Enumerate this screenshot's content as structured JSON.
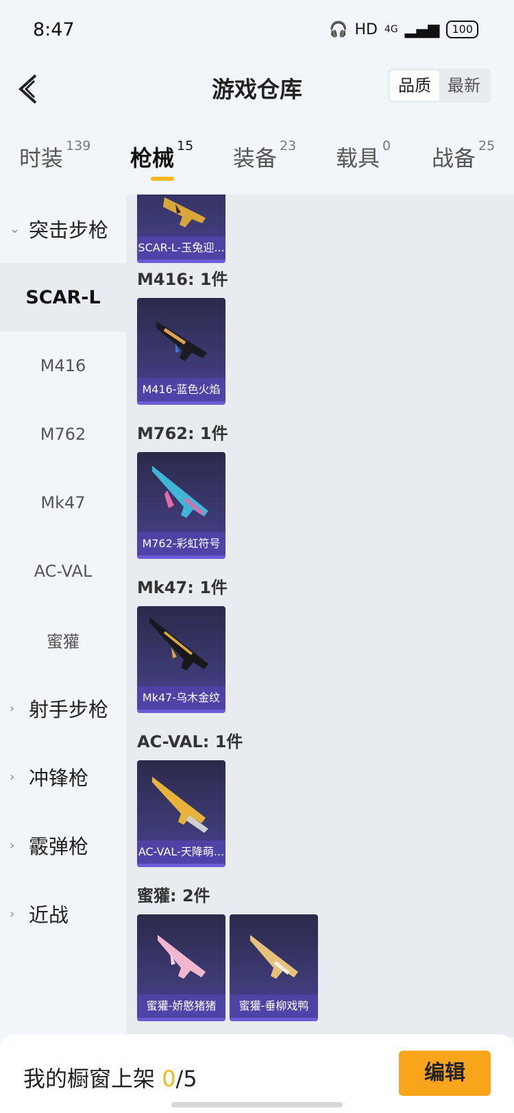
{
  "status_bar": {
    "time": "8:47",
    "network": "HD",
    "signal": "4G",
    "battery": "100"
  },
  "header": {
    "title": "游戏仓库",
    "sort_options": [
      "品质",
      "最新"
    ],
    "active_sort": "品质"
  },
  "tabs": [
    {
      "label": "时装",
      "count": "139"
    },
    {
      "label": "枪械",
      "count": "15",
      "active": true
    },
    {
      "label": "装备",
      "count": "23"
    },
    {
      "label": "载具",
      "count": "0"
    },
    {
      "label": "战备",
      "count": "25"
    }
  ],
  "sidebar": {
    "categories": [
      "突击步枪",
      "射手步枪",
      "冲锋枪",
      "霰弹枪",
      "近战"
    ],
    "sub_items": [
      "SCAR-L",
      "M416",
      "M762",
      "Mk47",
      "AC-VAL",
      "蜜獾"
    ],
    "selected": "SCAR-L"
  },
  "groups": [
    {
      "label": "",
      "items": [
        "SCAR-L-玉兔迎..."
      ]
    },
    {
      "label": "M416: 1件",
      "items": [
        "M416-蓝色火焰"
      ]
    },
    {
      "label": "M762: 1件",
      "items": [
        "M762-彩虹符号"
      ]
    },
    {
      "label": "Mk47: 1件",
      "items": [
        "Mk47-乌木金纹"
      ]
    },
    {
      "label": "AC-VAL: 1件",
      "items": [
        "AC-VAL-天降萌..."
      ]
    },
    {
      "label": "蜜獾: 2件",
      "items": [
        "蜜獾-娇憨猪猪",
        "蜜獾-垂柳戏鸭"
      ]
    }
  ],
  "footer": {
    "label_prefix": "我的橱窗上架 ",
    "count": "0",
    "total": "/5",
    "edit_label": "编辑"
  },
  "colors": {
    "accent": "#f6b81a",
    "button": "#f8a51b",
    "card": "#3c3a72"
  }
}
